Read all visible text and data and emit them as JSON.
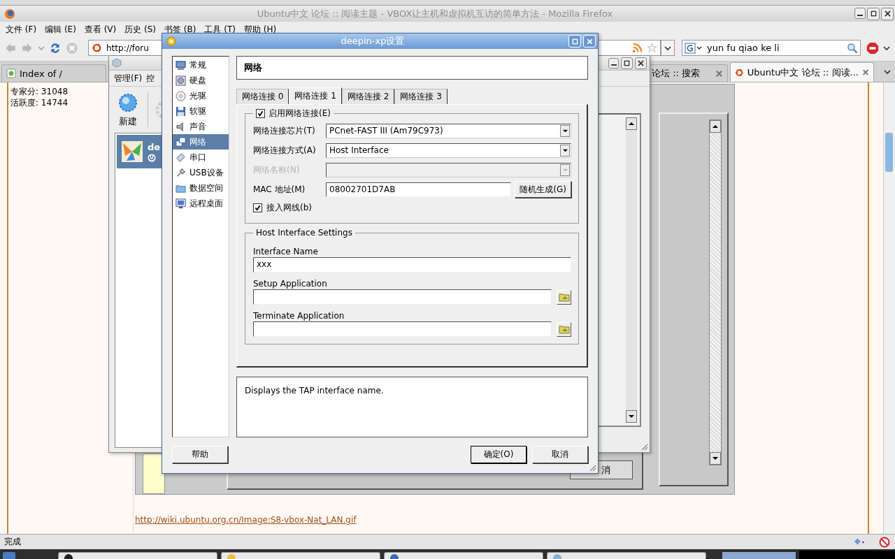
{
  "firefox": {
    "title": "Ubuntu中文 论坛 :: 阅读主题 - VBOX让主机和虚拟机互访的简单方法  - Mozilla Firefox",
    "menu": [
      "文件 (F)",
      "编辑 (E)",
      "查看 (V)",
      "历史 (S)",
      "书签 (B)",
      "工具 (T)",
      "帮助 (H)"
    ],
    "url": "http://foru",
    "search": "yun fu qiao ke li",
    "tabs": [
      {
        "label": "Index of /",
        "selected": false
      },
      {
        "label": "论坛 :: 搜索",
        "selected": false
      },
      {
        "label": "Ubuntu中文 论坛 :: 阅读...",
        "selected": true
      }
    ],
    "user_stats": [
      "专家分: 31048",
      "活跃度: 14744"
    ],
    "link": "http://wiki.ubuntu.org.cn/Image:S8-vbox-Nat_LAN.gif",
    "status": "完成"
  },
  "embedded_screenshot": {
    "button": "消"
  },
  "manager_window": {
    "menu": [
      "管理(F)",
      "控"
    ],
    "toolbar": [
      "新建"
    ],
    "vm_list": [
      {
        "name": "de",
        "selected": true
      }
    ]
  },
  "dialog": {
    "title": "deepin-xp设置",
    "sidebar": [
      {
        "label": "常规",
        "selected": false
      },
      {
        "label": "硬盘",
        "selected": false
      },
      {
        "label": "光驱",
        "selected": false
      },
      {
        "label": "软驱",
        "selected": false
      },
      {
        "label": "声音",
        "selected": false
      },
      {
        "label": "网络",
        "selected": true
      },
      {
        "label": "串口",
        "selected": false
      },
      {
        "label": "USB设备",
        "selected": false
      },
      {
        "label": "数据空间",
        "selected": false
      },
      {
        "label": "远程桌面",
        "selected": false
      }
    ],
    "heading": "网络",
    "tabs": [
      {
        "label": "网络连接 0",
        "selected": false
      },
      {
        "label": "网络连接 1",
        "selected": true
      },
      {
        "label": "网络连接 2",
        "selected": false
      },
      {
        "label": "网络连接 3",
        "selected": false
      }
    ],
    "enable": {
      "label": "启用网络连接(E)",
      "checked": true
    },
    "rows": [
      {
        "kind": "combo",
        "label": "网络连接芯片(T)",
        "value": "PCnet-FAST III (Am79C973)",
        "disabled": false
      },
      {
        "kind": "combo",
        "label": "网络连接方式(A)",
        "value": "Host Interface",
        "disabled": false
      },
      {
        "kind": "combo",
        "label": "网络名称(N)",
        "disabled": true
      },
      {
        "kind": "text",
        "label": "MAC 地址(M)",
        "value": "08002701D7AB",
        "button": "随机生成(G)",
        "disabled": false
      }
    ],
    "cable": {
      "label": "接入网线(b)",
      "checked": true
    },
    "host_group": {
      "title": "Host Interface Settings",
      "fields": [
        {
          "label": "Interface Name",
          "value": "xxx",
          "browse": false
        },
        {
          "label": "Setup Application",
          "browse": true
        },
        {
          "label": "Terminate Application",
          "browse": true
        }
      ]
    },
    "description": "Displays the TAP interface name.",
    "buttons": {
      "help": "帮助",
      "ok": "确定(O)",
      "cancel": "取消"
    }
  }
}
